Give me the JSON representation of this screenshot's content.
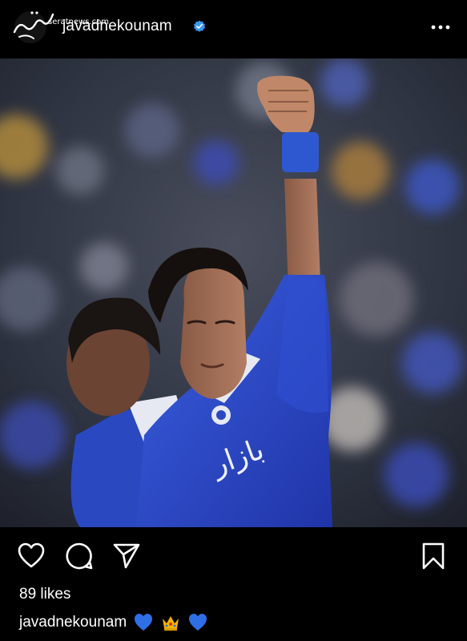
{
  "header": {
    "username": "javadnekounam",
    "verified": true,
    "watermark_logo_text": "صراط",
    "watermark_site": "seratnews.com",
    "more_icon": "more-horizontal-icon"
  },
  "post": {
    "image_description_icon": "photo-football-player-raised-fist",
    "jersey_text": "بازار",
    "colors": {
      "jersey_blue": "#2b49c9",
      "background": "#000000",
      "verified_blue": "#3897f0"
    }
  },
  "actions": {
    "like_icon": "heart-icon",
    "comment_icon": "comment-icon",
    "share_icon": "send-icon",
    "save_icon": "bookmark-icon"
  },
  "likes_text": "89 likes",
  "caption": {
    "username": "javadnekounam",
    "emojis": [
      "blue-heart-icon",
      "crown-icon",
      "blue-heart-icon"
    ]
  }
}
